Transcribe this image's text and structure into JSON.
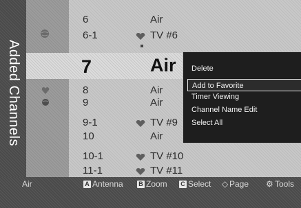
{
  "screen": {
    "title": "Added Channels"
  },
  "channels": [
    {
      "number": "6",
      "name": "Air",
      "favorite": false
    },
    {
      "number": "6-1",
      "name": "TV #6",
      "favorite": true
    },
    {
      "number": "7",
      "name": "Air",
      "favorite": false,
      "selected": true
    },
    {
      "number": "8",
      "name": "Air",
      "favorite": false
    },
    {
      "number": "9",
      "name": "Air",
      "favorite": false
    },
    {
      "number": "9-1",
      "name": "TV #9",
      "favorite": true
    },
    {
      "number": "10",
      "name": "Air",
      "favorite": false
    },
    {
      "number": "10-1",
      "name": "TV #10",
      "favorite": true
    },
    {
      "number": "11-1",
      "name": "TV #11",
      "favorite": true
    }
  ],
  "popup_menu": {
    "items": [
      "Delete",
      "Add to Favorite",
      "Timer Viewing",
      "Channel Name Edit",
      "Select All"
    ],
    "highlighted": "Add to Favorite"
  },
  "bottom_bar": {
    "source": "Air",
    "keys": [
      {
        "key": "A",
        "label": "Antenna"
      },
      {
        "key": "B",
        "label": "Zoom"
      },
      {
        "key": "C",
        "label": "Select"
      }
    ],
    "page_label": "Page",
    "tools_label": "Tools"
  },
  "icons": {
    "tv_icon": "tv-icon",
    "globe_icon": "globe-icon",
    "heart_icon": "heart-icon"
  }
}
